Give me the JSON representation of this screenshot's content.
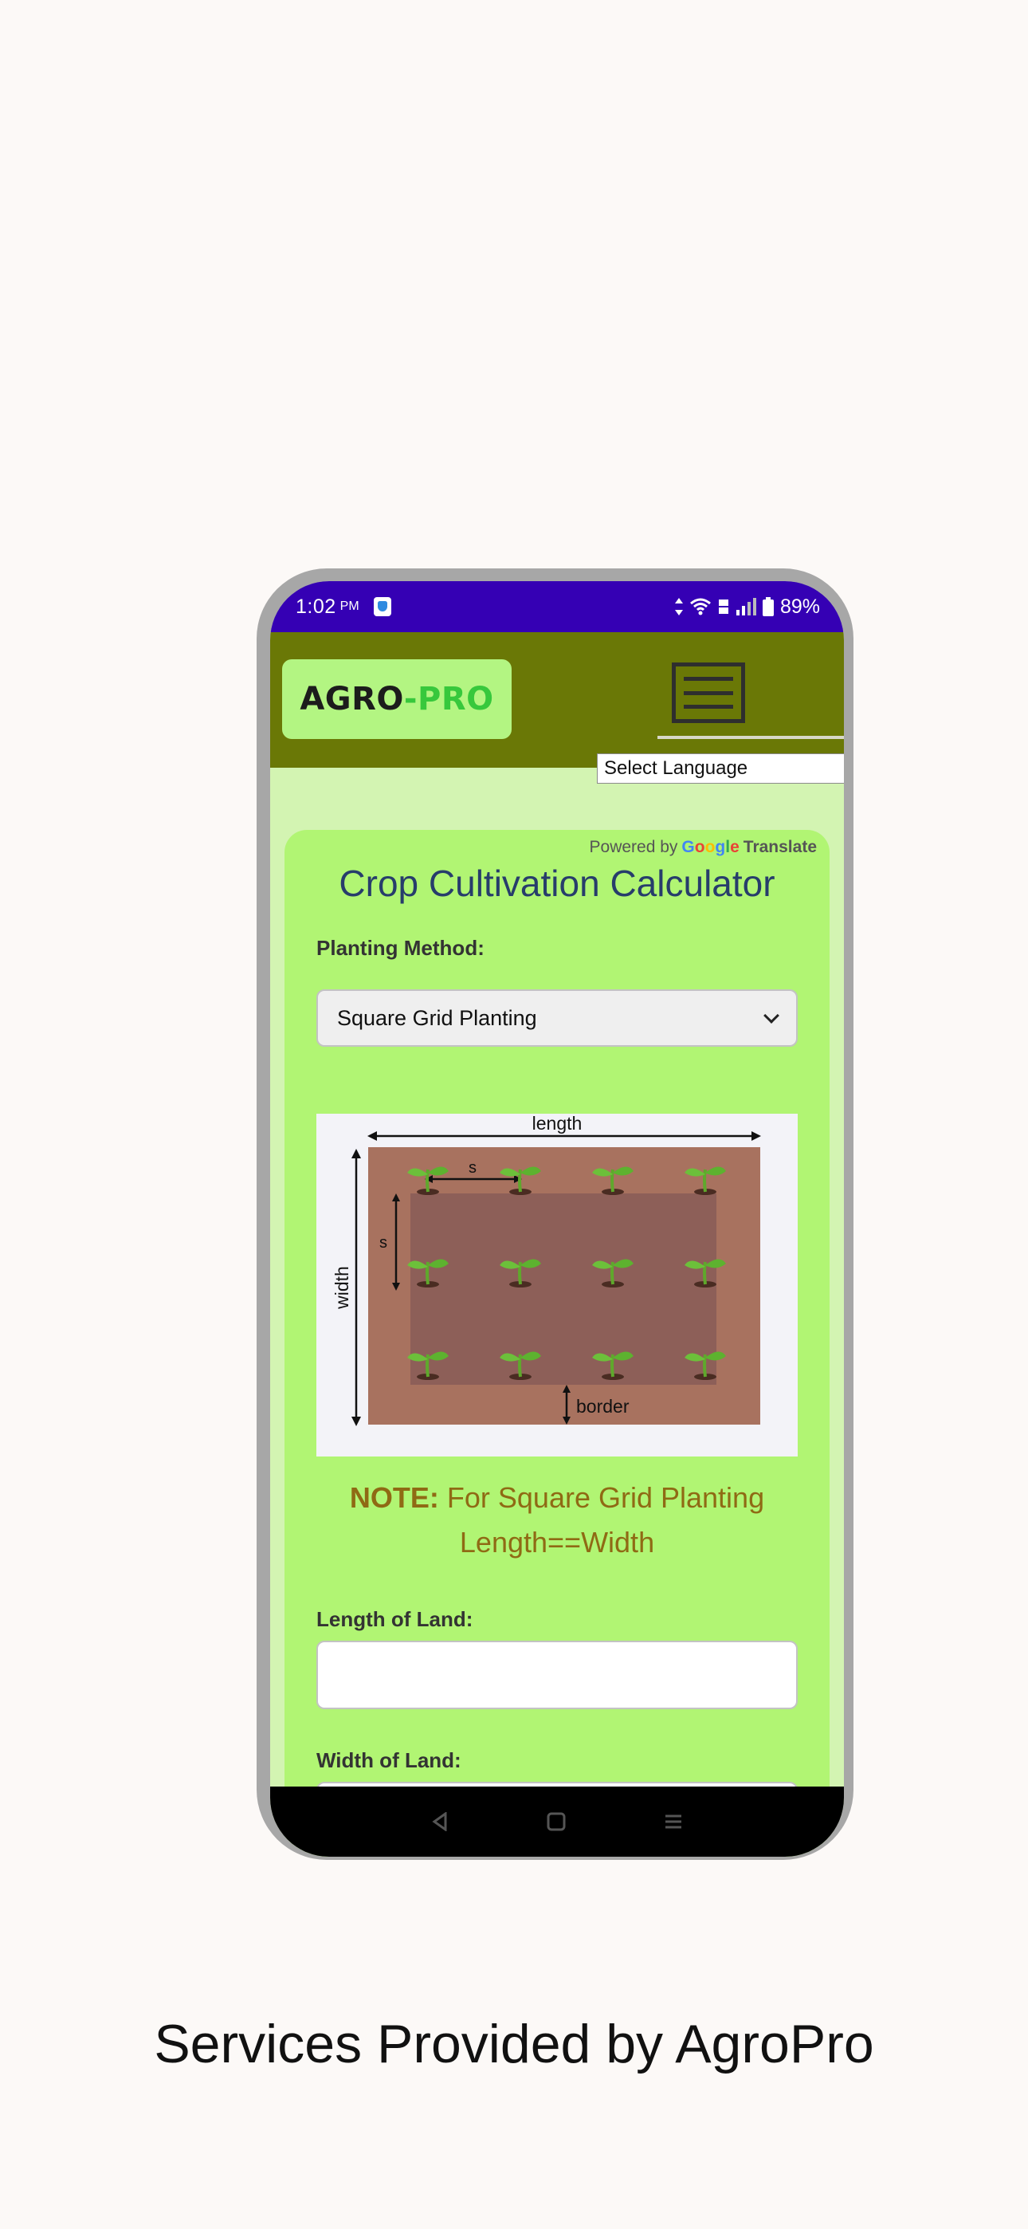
{
  "status_bar": {
    "time": "1:02",
    "ampm": "PM",
    "battery": "89%"
  },
  "header": {
    "logo_part1": "AGRO",
    "logo_part2": "-PRO",
    "language_select": "Select Language"
  },
  "translate_widget": {
    "powered_by": "Powered by",
    "google": "Google",
    "translate": "Translate"
  },
  "calculator": {
    "title": "Crop Cultivation Calculator",
    "planting_method_label": "Planting Method:",
    "planting_method_value": "Square Grid Planting",
    "diagram": {
      "length": "length",
      "width": "width",
      "spacing": "s",
      "border": "border"
    },
    "note_bold": "NOTE:",
    "note_text": " For Square Grid Planting Length==Width",
    "length_label": "Length of Land:",
    "width_label": "Width of Land:"
  },
  "caption": "Services Provided by AgroPro",
  "colors": {
    "status_bar": "#3500b4",
    "header": "#6a7806",
    "card": "#b1f573",
    "logo_bg": "#b3f582",
    "logo_accent": "#37c83c",
    "title": "#273d6b",
    "note": "#8f6a14"
  }
}
